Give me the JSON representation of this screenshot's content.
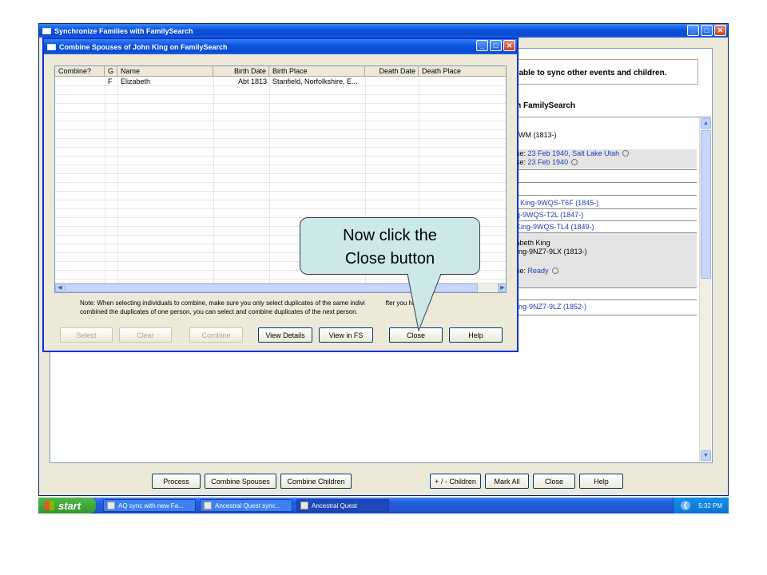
{
  "main_window": {
    "title": "Synchronize Families with FamilySearch",
    "info_text": "be able to sync other events and children.",
    "section_heading": "s in FamilySearch",
    "records": {
      "r1_line1": "th",
      "r1_line2": "-9WM (1813-)",
      "r1_line3_label": "use:",
      "r1_line3_link": "23 Feb 1940, Salt Lake Utah",
      "r1_line4_label": "use:",
      "r1_line4_link": "23 Feb 1940",
      "child1": "V. King-9WQS-T6F (1845-)",
      "child2": "ng-9WQS-T2L (1847-)",
      "child3": ". King-9WQS-TL4 (1849-)",
      "r2_line1": "zabeth King",
      "r2_line2": "King-9NZ7-9LX (1813-)",
      "r2_line3_label": "use:",
      "r2_line3_link": "Ready",
      "child4": "King-9NZ7-9LZ (1852-)"
    },
    "bottom_buttons": {
      "process": "Process",
      "combine_spouses": "Combine Spouses",
      "combine_children": "Combine Children",
      "plus_minus_children": "+ / - Children",
      "mark_all": "Mark All",
      "close": "Close",
      "help": "Help"
    }
  },
  "dialog": {
    "title": "Combine Spouses of John King on FamilySearch",
    "columns": [
      "Combine?",
      "G",
      "Name",
      "Birth Date",
      "Birth Place",
      "Death Date",
      "Death Place"
    ],
    "rows": [
      [
        "",
        "F",
        "Elizabeth",
        "Abt 1813",
        "Stanfield, Norfolkshire, E...",
        "",
        ""
      ]
    ],
    "note": "Note: When selecting individuals to combine, make sure you only select duplicates of the same indivi",
    "note_tail": "fter you have",
    "note_line2": "combined the duplicates of one person, you can select and combine duplicates of the next person.",
    "buttons": {
      "select": "Select",
      "clear": "Clear",
      "combine": "Combine",
      "view_details": "View Details",
      "view_in_fs": "View in FS",
      "close": "Close",
      "help": "Help"
    }
  },
  "callout": {
    "line1": "Now click the",
    "line2": "Close button"
  },
  "taskbar": {
    "start": "start",
    "tasks": [
      "AQ sync with new Fa...",
      "Ancestral Quest sync...",
      "Ancestral Quest"
    ],
    "clock": "5:32 PM"
  },
  "colors": {
    "titlebar_blue": "#0d55e0",
    "link_blue": "#1a3fae",
    "callout_fill": "#cce8e8",
    "window_face": "#ece9d8"
  }
}
